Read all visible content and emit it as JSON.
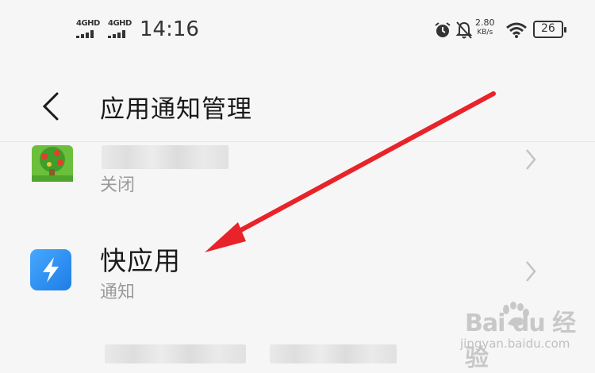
{
  "status_bar": {
    "signal1_label": "4GHD",
    "signal2_label": "4GHD",
    "time": "14:16",
    "speed_value": "2.80",
    "speed_unit": "KB/s",
    "battery_level": "26",
    "icons": [
      "alarm-icon",
      "notifications-off-icon",
      "wifi-icon",
      "battery-icon"
    ]
  },
  "header": {
    "back_icon": "chevron-left-icon",
    "title": "应用通知管理"
  },
  "list": [
    {
      "icon": "game-app-icon",
      "title": "",
      "subtitle": "关闭",
      "chevron": "chevron-right-icon"
    },
    {
      "icon": "quick-app-icon",
      "title": "快应用",
      "subtitle": "通知",
      "chevron": "chevron-right-icon"
    },
    {
      "icon": "",
      "title": "",
      "subtitle": ""
    }
  ],
  "watermark": {
    "main": "Bai du 经验",
    "url": "jingyan.baidu.com"
  },
  "colors": {
    "background": "#f6f6f6",
    "annotation_arrow": "#e8232a",
    "quick_app_icon": "#2a8df0",
    "secondary_text": "#9a9a9a"
  }
}
